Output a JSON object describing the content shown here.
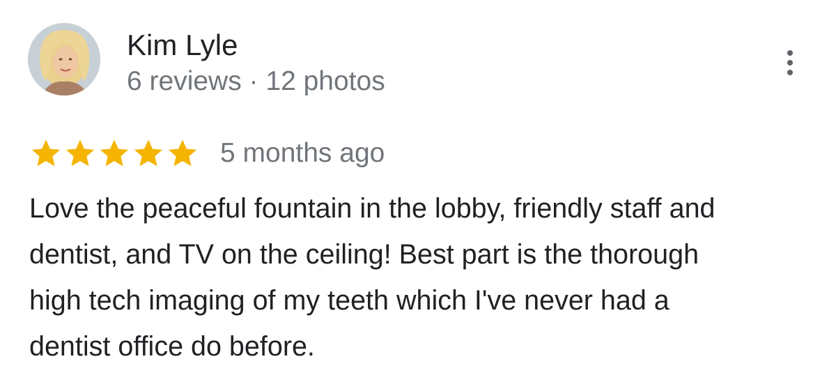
{
  "review": {
    "author_name": "Kim Lyle",
    "author_meta": "6 reviews · 12 photos",
    "rating": 5,
    "rating_max": 5,
    "time": "5 months ago",
    "text_lines": [
      "Love the peaceful fountain in the lobby, friendly staff and",
      "dentist, and TV on the ceiling! Best part is the thorough",
      "high tech imaging of my teeth which I've never had a",
      "dentist office do before."
    ]
  },
  "icons": {
    "star": "star-icon",
    "menu": "more-vert-icon"
  },
  "colors": {
    "star_fill": "#f4b400",
    "author_name": "#202124",
    "meta_text": "#70757a",
    "body_text": "#202124",
    "menu_dots": "#5f6368"
  }
}
